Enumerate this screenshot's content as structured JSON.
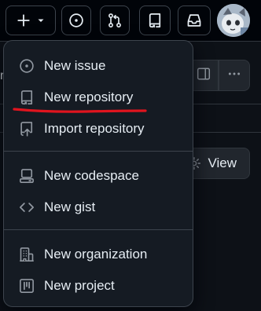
{
  "header": {
    "create_icon": "plus-icon",
    "create_caret_icon": "triangle-down-icon",
    "issues_icon": "issue-opened-icon",
    "pulls_icon": "git-pull-request-icon",
    "repos_icon": "repo-icon",
    "inbox_icon": "inbox-icon",
    "avatar": "user-avatar"
  },
  "background": {
    "view_button_label": "View",
    "view_icon": "gear-icon"
  },
  "menu": {
    "items": [
      {
        "label": "New issue",
        "icon": "issue-opened-icon"
      },
      {
        "label": "New repository",
        "icon": "repo-icon"
      },
      {
        "label": "Import repository",
        "icon": "repo-push-icon"
      },
      {
        "label": "New codespace",
        "icon": "codespaces-icon"
      },
      {
        "label": "New gist",
        "icon": "code-icon"
      },
      {
        "label": "New organization",
        "icon": "organization-icon"
      },
      {
        "label": "New project",
        "icon": "project-icon"
      }
    ]
  },
  "annotation": {
    "highlight_color": "#e0141e",
    "highlighted_item": "New repository"
  },
  "colors": {
    "page_bg": "#0d1117",
    "header_bg": "#010409",
    "menu_bg": "#151b23",
    "border": "#3d444d",
    "text": "#e6edf3",
    "icon": "#9198a1"
  }
}
